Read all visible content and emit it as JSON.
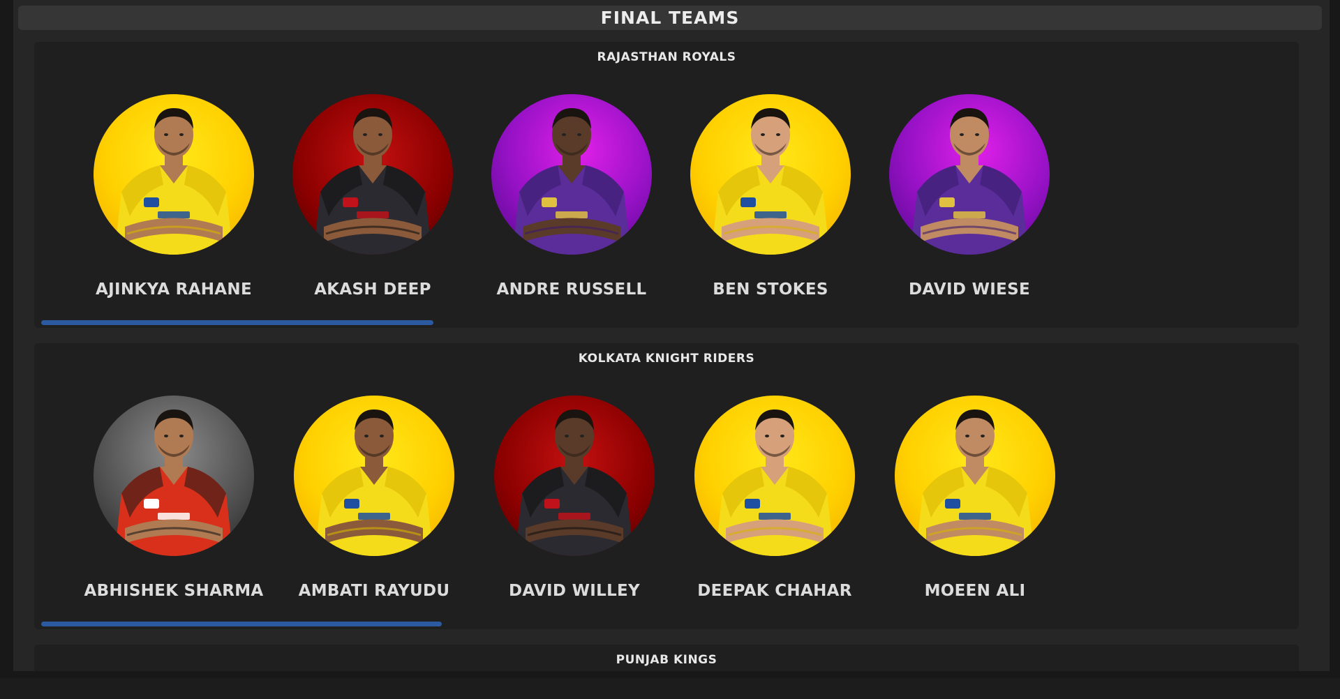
{
  "page": {
    "title": "FINAL TEAMS",
    "accent_color": "#2b5aa0"
  },
  "teams": [
    {
      "name": "RAJASTHAN ROYALS",
      "scroll_position": 0.31,
      "players": [
        {
          "name": "AJINKYA RAHANE",
          "jersey": "yellow",
          "bg": "yellow"
        },
        {
          "name": "AKASH DEEP",
          "jersey": "red-black",
          "bg": "red"
        },
        {
          "name": "ANDRE RUSSELL",
          "jersey": "purple",
          "bg": "purple"
        },
        {
          "name": "BEN STOKES",
          "jersey": "yellow",
          "bg": "yellow"
        },
        {
          "name": "DAVID WIESE",
          "jersey": "purple",
          "bg": "purple"
        }
      ]
    },
    {
      "name": "KOLKATA KNIGHT RIDERS",
      "scroll_position": 0.32,
      "players": [
        {
          "name": "ABHISHEK SHARMA",
          "jersey": "orange-black",
          "bg": "grey"
        },
        {
          "name": "AMBATI RAYUDU",
          "jersey": "yellow",
          "bg": "yellow"
        },
        {
          "name": "DAVID WILLEY",
          "jersey": "red-black",
          "bg": "red"
        },
        {
          "name": "DEEPAK CHAHAR",
          "jersey": "yellow",
          "bg": "yellow"
        },
        {
          "name": "MOEEN ALI",
          "jersey": "yellow",
          "bg": "yellow"
        }
      ]
    },
    {
      "name": "PUNJAB KINGS",
      "players": []
    }
  ]
}
